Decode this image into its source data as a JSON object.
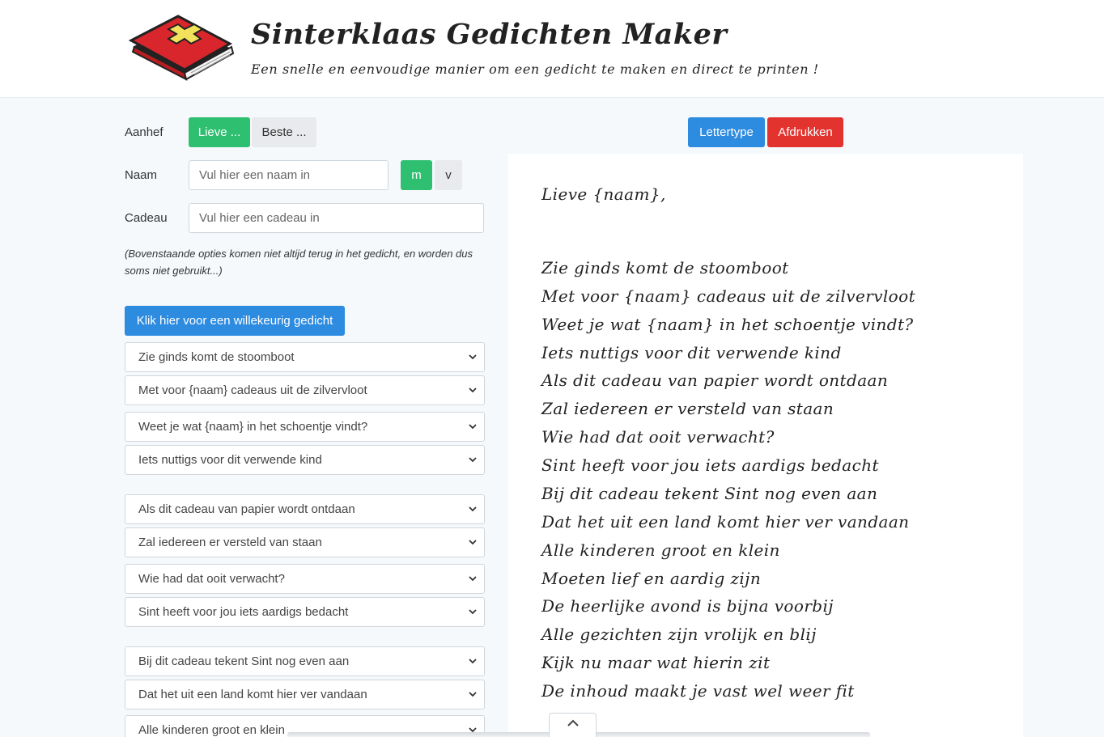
{
  "header": {
    "title": "Sinterklaas Gedichten Maker",
    "subtitle": "Een snelle en eenvoudige manier om een gedicht te maken en direct te printen !",
    "logo_icon": "red-book-with-cross-icon"
  },
  "form": {
    "aanhef_label": "Aanhef",
    "aanhef_options": [
      "Lieve ...",
      "Beste ..."
    ],
    "aanhef_selected": "Lieve ...",
    "naam_label": "Naam",
    "naam_placeholder": "Vul hier een naam in",
    "naam_value": "",
    "gender_options": [
      "m",
      "v"
    ],
    "gender_selected": "m",
    "cadeau_label": "Cadeau",
    "cadeau_placeholder": "Vul hier een cadeau in",
    "cadeau_value": "",
    "note": "(Bovenstaande opties komen niet altijd terug in het gedicht, en worden dus soms niet gebruikt...)",
    "random_button": "Klik hier voor een willekeurig gedicht"
  },
  "line_selects": [
    "Zie ginds komt de stoomboot",
    "Met voor {naam} cadeaus uit de zilvervloot",
    "Weet je wat {naam} in het schoentje vindt?",
    "Iets nuttigs voor dit verwende kind",
    "Als dit cadeau van papier wordt ontdaan",
    "Zal iedereen er versteld van staan",
    "Wie had dat ooit verwacht?",
    "Sint heeft voor jou iets aardigs bedacht",
    "Bij dit cadeau tekent Sint nog even aan",
    "Dat het uit een land komt hier ver vandaan",
    "Alle kinderen groot en klein"
  ],
  "toolbar": {
    "font_button": "Lettertype",
    "print_button": "Afdrukken"
  },
  "poem": {
    "greeting": "Lieve {naam},",
    "lines": [
      "Zie ginds komt de stoomboot",
      "Met voor {naam} cadeaus uit de zilvervloot",
      "Weet je wat {naam} in het schoentje vindt?",
      "Iets nuttigs voor dit verwende kind",
      "Als dit cadeau van papier wordt ontdaan",
      "Zal iedereen er versteld van staan",
      "Wie had dat ooit verwacht?",
      "Sint heeft voor jou iets aardigs bedacht",
      "Bij dit cadeau tekent Sint nog even aan",
      "Dat het uit een land komt hier ver vandaan",
      "Alle kinderen groot en klein",
      "Moeten lief en aardig zijn",
      "De heerlijke avond is bijna voorbij",
      "Alle gezichten zijn vrolijk en blij",
      "Kijk nu maar wat hierin zit",
      "De inhoud maakt je vast wel weer fit"
    ]
  },
  "colors": {
    "green": "#2fbf71",
    "blue": "#2d8be0",
    "red": "#e3332f"
  },
  "scroll_top_icon": "chevron-up-icon"
}
